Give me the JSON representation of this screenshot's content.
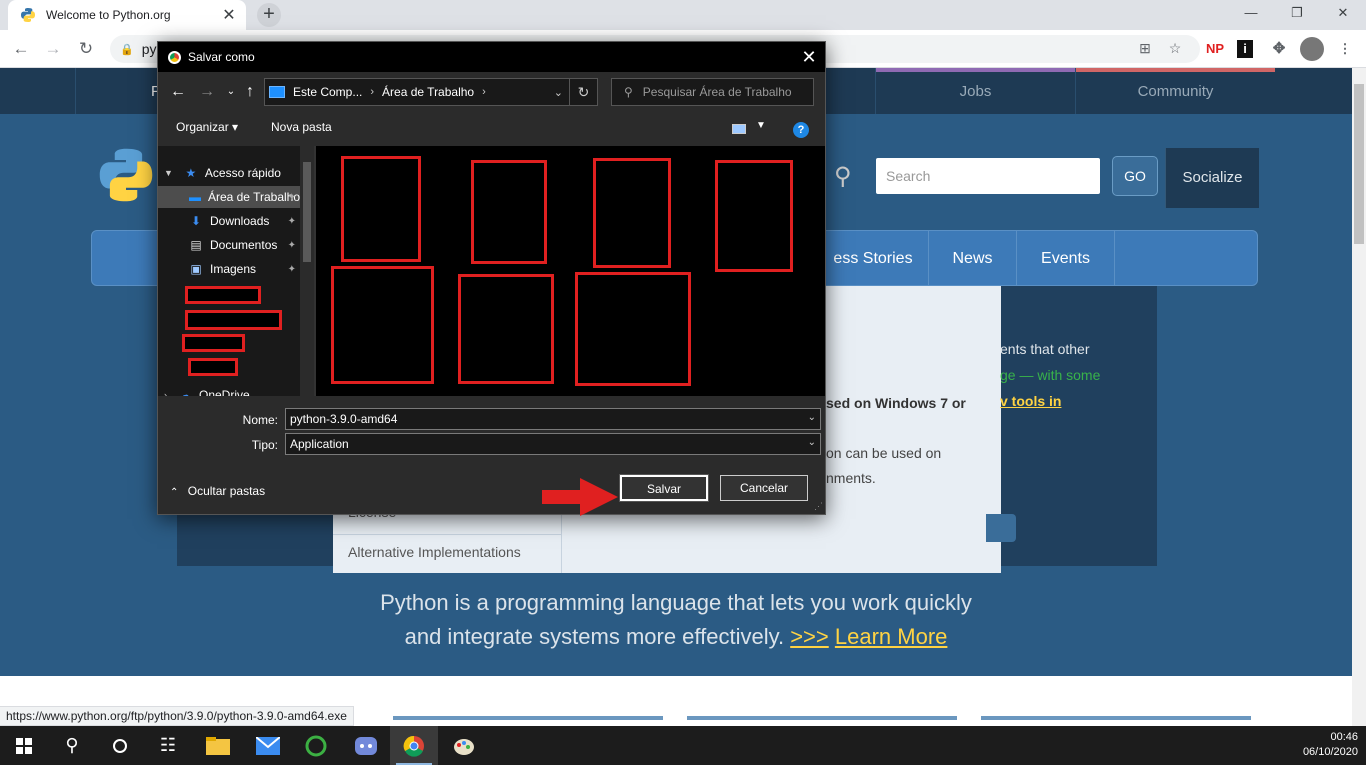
{
  "browser": {
    "tab_title": "Welcome to Python.org",
    "url_fragment": "py",
    "ext_np": "NP",
    "ext_i": "i",
    "tab_close": "✕",
    "newtab": "+",
    "win_min": "—",
    "win_restore": "❐",
    "win_close": "✕"
  },
  "site": {
    "topnav": [
      "Jobs",
      "Community"
    ],
    "topnav_first_letter": "P",
    "search_placeholder": "Search",
    "go_label": "GO",
    "socialize_label": "Socialize",
    "mainnav": [
      "ess Stories",
      "News",
      "Events"
    ],
    "side_links": [
      "License",
      "Alternative Implementations"
    ],
    "body_lines": [
      "ents that other",
      "ge — with some",
      "sed on Windows 7 or",
      "v tools in",
      "on can be used on",
      "nments."
    ],
    "tagline_line1": "Python is a programming language that lets you work quickly",
    "tagline_line2": "and integrate systems more effectively.",
    "tagline_chevrons": ">>>",
    "learn_more": "Learn More",
    "status_url": "https://www.python.org/ftp/python/3.9.0/python-3.9.0-amd64.exe"
  },
  "dialog": {
    "title": "Salvar como",
    "close": "✕",
    "address_parts": [
      "Este Comp...",
      "Área de Trabalho"
    ],
    "search_placeholder": "Pesquisar Área de Trabalho",
    "organize_label": "Organizar ▾",
    "new_folder_label": "Nova pasta",
    "help_label": "?",
    "nav_items": [
      {
        "label": "Acesso rápido",
        "icon": "star-icon"
      },
      {
        "label": "Área de Trabalho",
        "icon": "desktop-icon"
      },
      {
        "label": "Downloads",
        "icon": "download-icon"
      },
      {
        "label": "Documentos",
        "icon": "document-icon"
      },
      {
        "label": "Imagens",
        "icon": "image-icon"
      },
      {
        "label": "OneDrive",
        "icon": "cloud-icon"
      }
    ],
    "name_label": "Nome:",
    "name_value": "python-3.9.0-amd64",
    "type_label": "Tipo:",
    "type_value": "Application",
    "hide_folders_label": "Ocultar pastas",
    "save_label": "Salvar",
    "cancel_label": "Cancelar"
  },
  "taskbar": {
    "time": "00:46",
    "date": "06/10/2020"
  },
  "colors": {
    "python_blue": "#2b5b84",
    "python_yellow": "#ffd343",
    "redaction": "#e02020"
  }
}
